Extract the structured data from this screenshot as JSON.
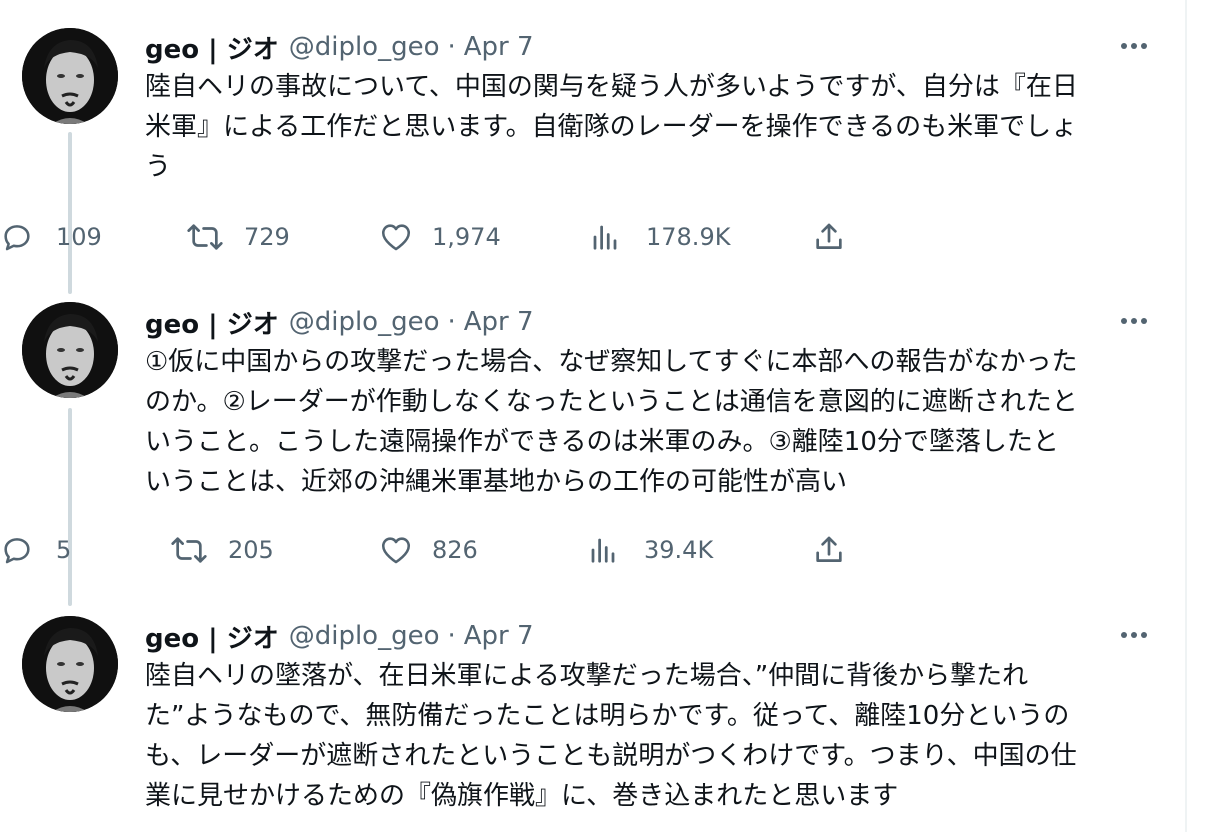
{
  "tweets": [
    {
      "name": "geo | ジオ",
      "handle": "@diplo_geo",
      "separator": "·",
      "date": "Apr 7",
      "text": "陸自ヘリの事故について、中国の関与を疑う人が多いようですが、自分は『在日\n米軍』による工作だと思います。自衛隊のレーダーを操作できるのも米軍でしょ\nう",
      "replies": "109",
      "reposts": "729",
      "likes": "1,974",
      "views": "178.9K"
    },
    {
      "name": "geo | ジオ",
      "handle": "@diplo_geo",
      "separator": "·",
      "date": "Apr 7",
      "text": "①仮に中国からの攻撃だった場合、なぜ察知してすぐに本部への報告がなかった\nのか。②レーダーが作動しなくなったということは通信を意図的に遮断されたと\nいうこと。こうした遠隔操作ができるのは米軍のみ。③離陸10分で墜落したと\nいうことは、近郊の沖縄米軍基地からの工作の可能性が高い",
      "replies": "5",
      "reposts": "205",
      "likes": "826",
      "views": "39.4K"
    },
    {
      "name": "geo | ジオ",
      "handle": "@diplo_geo",
      "separator": "·",
      "date": "Apr 7",
      "text": "陸自ヘリの墜落が、在日米軍による攻撃だった場合、”仲間に背後から撃たれ\nた”ようなもので、無防備だったことは明らかです。従って、離陸10分というの\nも、レーダーが遮断されたということも説明がつくわけです。つまり、中国の仕\n業に見せかけるための『偽旗作戦』に、巻き込まれたと思います"
    }
  ]
}
